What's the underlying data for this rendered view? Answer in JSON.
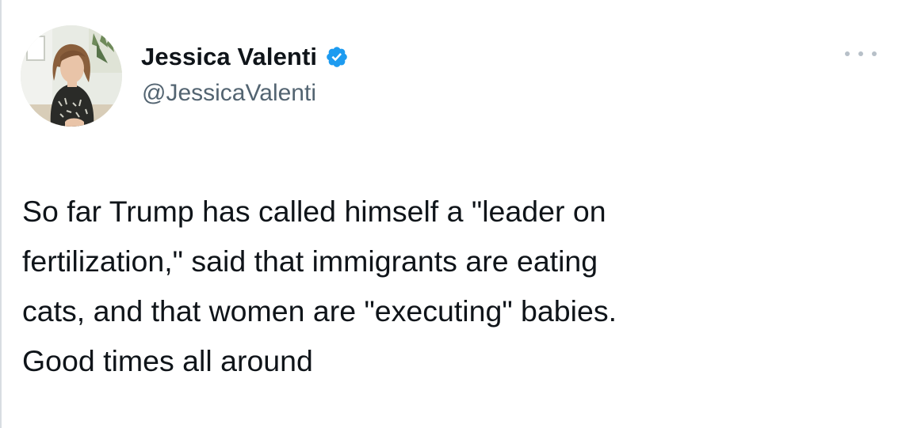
{
  "author": {
    "display_name": "Jessica Valenti",
    "handle": "@JessicaValenti",
    "verified": true,
    "avatar_icon": "profile-photo",
    "verified_icon": "verified-badge-icon"
  },
  "actions": {
    "more_icon": "more-options-icon"
  },
  "tweet": {
    "lines": [
      "So far Trump has called himself a \"leader on",
      "fertilization,\" said that immigrants are eating",
      "cats, and that women are \"executing\" babies.",
      "Good times all around"
    ]
  },
  "colors": {
    "text_primary": "#0f1419",
    "text_secondary": "#536471",
    "verified_blue": "#1d9bf0",
    "more_dots": "#b7c0c8"
  }
}
